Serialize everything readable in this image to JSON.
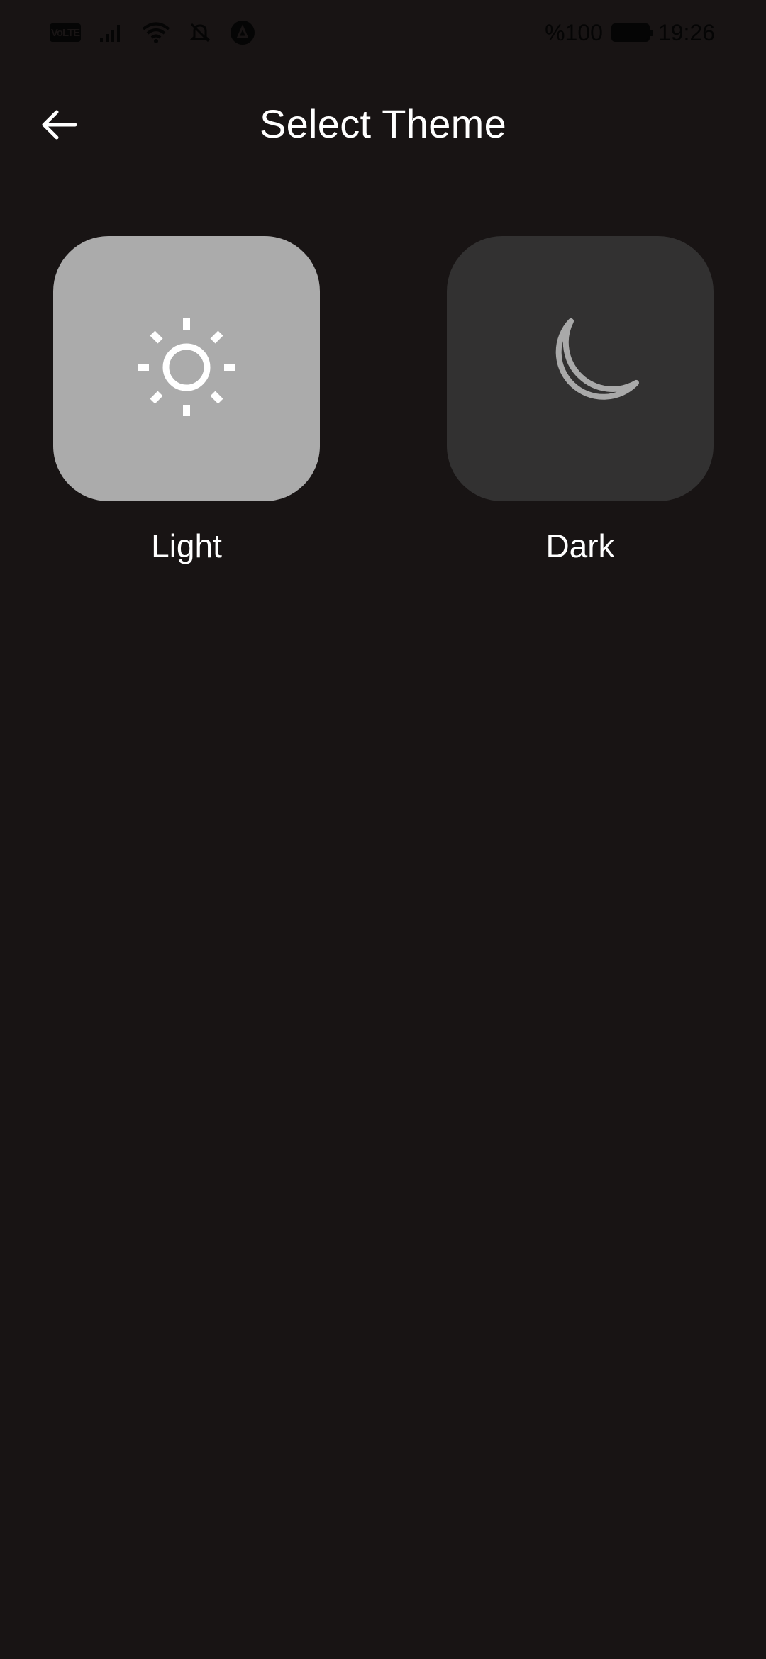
{
  "status_bar": {
    "network_badge": "VoLTE",
    "battery_percent": "%100",
    "time": "19:26",
    "icons": [
      "volte-icon",
      "signal-icon",
      "wifi-icon",
      "bell-off-icon",
      "app-notification-icon",
      "battery-icon"
    ]
  },
  "header": {
    "title": "Select Theme",
    "back_icon": "arrow-left-icon"
  },
  "themes": [
    {
      "label": "Light",
      "icon": "sun-icon",
      "tile_color": "#ababab"
    },
    {
      "label": "Dark",
      "icon": "moon-icon",
      "tile_color": "#323131"
    }
  ],
  "colors": {
    "background": "#181414",
    "text": "#ffffff",
    "icon_on_light": "#ffffff",
    "icon_on_dark": "#a9a9a9"
  }
}
